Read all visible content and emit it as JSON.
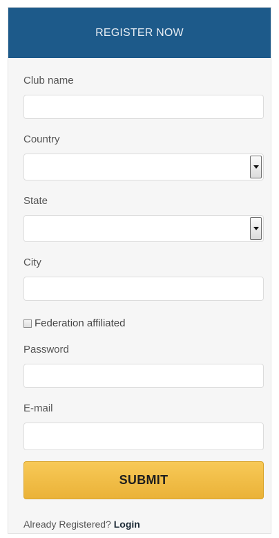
{
  "header": {
    "title": "REGISTER NOW"
  },
  "form": {
    "club_name": {
      "label": "Club name",
      "value": ""
    },
    "country": {
      "label": "Country",
      "value": ""
    },
    "state": {
      "label": "State",
      "value": ""
    },
    "city": {
      "label": "City",
      "value": ""
    },
    "federation": {
      "label": "Federation affiliated",
      "checked": false
    },
    "password": {
      "label": "Password",
      "value": ""
    },
    "email": {
      "label": "E-mail",
      "value": ""
    },
    "submit_label": "SUBMIT"
  },
  "footer": {
    "prompt": "Already Registered?",
    "login_label": "Login"
  },
  "colors": {
    "header_bg": "#1d5a8a",
    "submit_bg": "#f0bd46",
    "panel_bg": "#f6f6f6"
  }
}
